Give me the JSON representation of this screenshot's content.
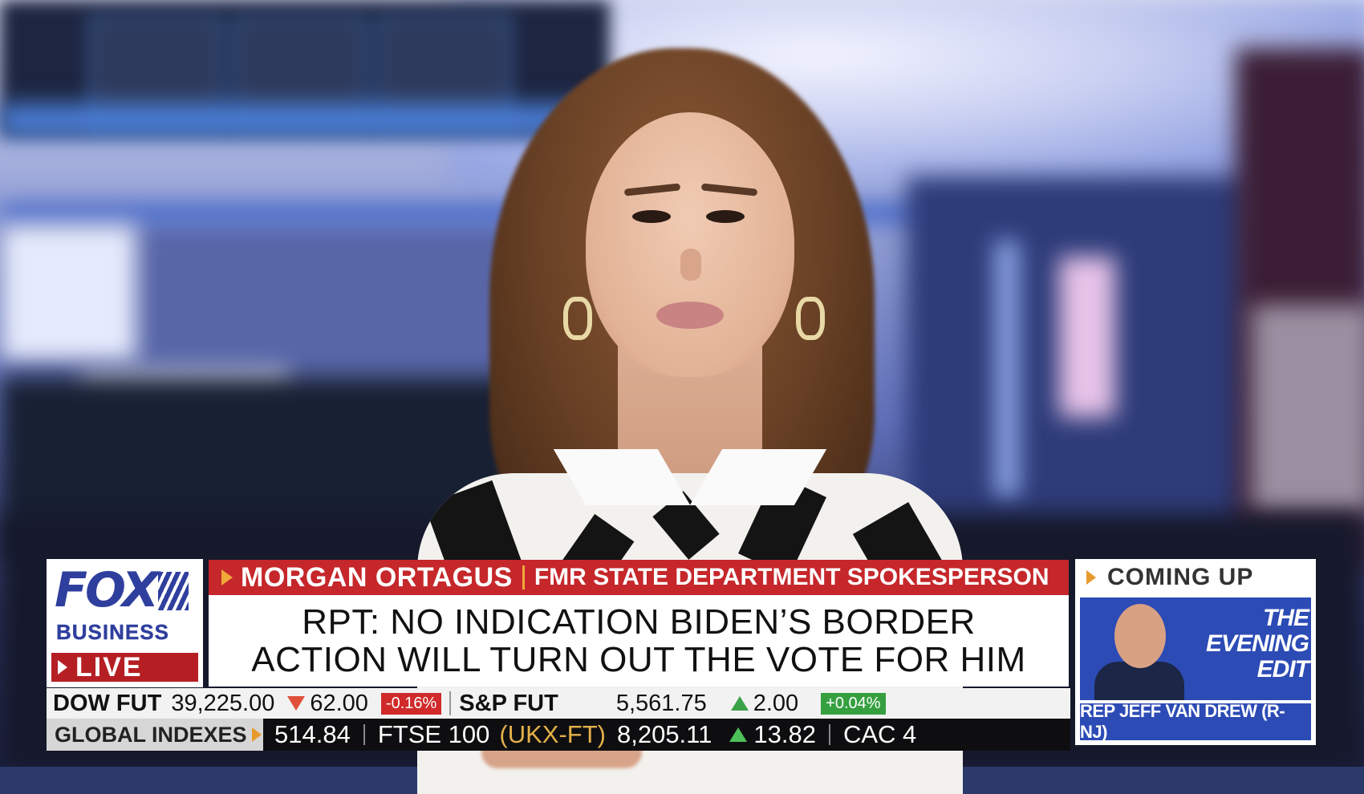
{
  "network": {
    "logo_main": "FOX",
    "logo_sub": "BUSINESS",
    "live_label": "LIVE"
  },
  "lower_third": {
    "name": "MORGAN ORTAGUS",
    "title": "FMR STATE DEPARTMENT SPOKESPERSON",
    "headline_line1": "RPT: NO INDICATION BIDEN’S BORDER",
    "headline_line2": "ACTION WILL TURN OUT THE VOTE FOR HIM"
  },
  "ticker_top": {
    "dow_label": "DOW FUT",
    "dow_value": "39,225.00",
    "dow_change": "62.00",
    "dow_pct": "-0.16%",
    "sp_label": "S&P FUT",
    "sp_value": "5,561.75",
    "sp_change": "2.00",
    "sp_pct": "+0.04%"
  },
  "ticker_bottom": {
    "section_label": "GLOBAL INDEXES",
    "prev_value": "514.84",
    "ftse_label": "FTSE 100",
    "ftse_code": "(UKX-FT)",
    "ftse_value": "8,205.11",
    "ftse_change": "13.82",
    "next_label": "CAC 4"
  },
  "coming_up": {
    "label": "COMING UP",
    "show_line1": "THE",
    "show_line2": "EVENING",
    "show_line3": "EDIT",
    "guest": "REP JEFF VAN DREW (R-NJ)"
  },
  "colors": {
    "fox_blue": "#2f3f9e",
    "live_red": "#b51f23",
    "name_bar_red": "#c5272b",
    "accent_orange": "#f0a93a",
    "down_red": "#e0503a",
    "up_green": "#3ca24a"
  }
}
